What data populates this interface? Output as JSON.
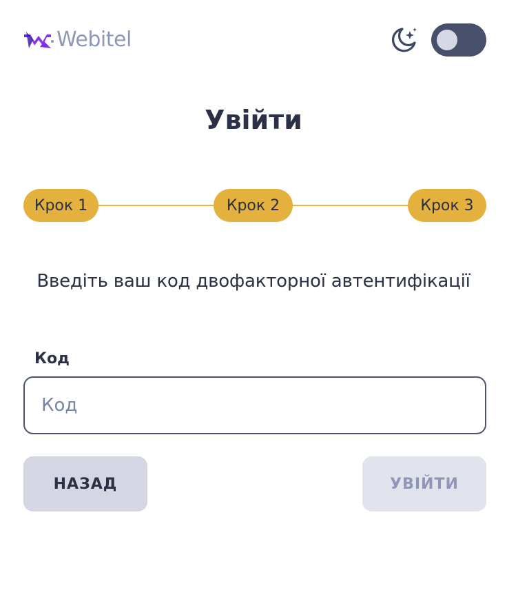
{
  "header": {
    "brand_name": "Webitel",
    "theme_icon": "moon-stars-icon",
    "theme_toggle_on": false
  },
  "title": "Увійти",
  "stepper": {
    "steps": [
      {
        "label": "Крок 1"
      },
      {
        "label": "Крок 2"
      },
      {
        "label": "Крок 3"
      }
    ]
  },
  "instruction": "Введіть ваш код двофакторної автентифікації",
  "form": {
    "code_label": "Код",
    "code_placeholder": "Код",
    "code_value": ""
  },
  "buttons": {
    "back_label": "НАЗАД",
    "login_label": "УВІЙТИ",
    "login_enabled": false
  },
  "colors": {
    "accent_step": "#e4b13e",
    "text_primary": "#2b3044",
    "logo_purple": "#7b2ff2",
    "toggle_track": "#474f6b"
  }
}
